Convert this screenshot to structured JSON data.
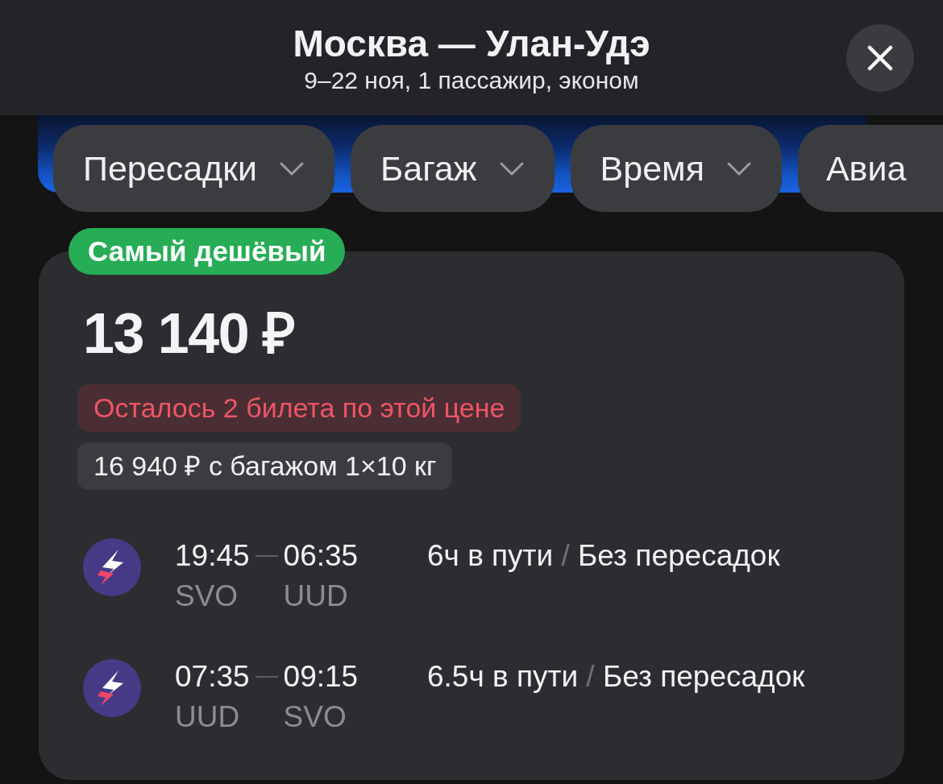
{
  "header": {
    "title": "Москва — Улан-Удэ",
    "subtitle": "9–22 ноя, 1 пассажир, эконом"
  },
  "filters": [
    {
      "label": "Пересадки",
      "chevron": true
    },
    {
      "label": "Багаж",
      "chevron": true
    },
    {
      "label": "Время",
      "chevron": true
    },
    {
      "label": "Авиа",
      "chevron": false
    }
  ],
  "offer": {
    "badge": "Самый дешёвый",
    "price": "13 140 ₽",
    "notices": [
      {
        "kind": "warning",
        "text": "Осталось 2 билета по этой цене"
      },
      {
        "kind": "info",
        "text": "16 940 ₽ с багажом 1×10 кг"
      }
    ],
    "flights": [
      {
        "departure_time": "19:45",
        "arrival_time": "06:35",
        "departure_airport": "SVO",
        "arrival_airport": "UUD",
        "duration": "6ч в пути",
        "separator": "/",
        "stops": "Без пересадок"
      },
      {
        "departure_time": "07:35",
        "arrival_time": "09:15",
        "departure_airport": "UUD",
        "arrival_airport": "SVO",
        "duration": "6.5ч в пути",
        "separator": "/",
        "stops": "Без пересадок"
      }
    ]
  }
}
